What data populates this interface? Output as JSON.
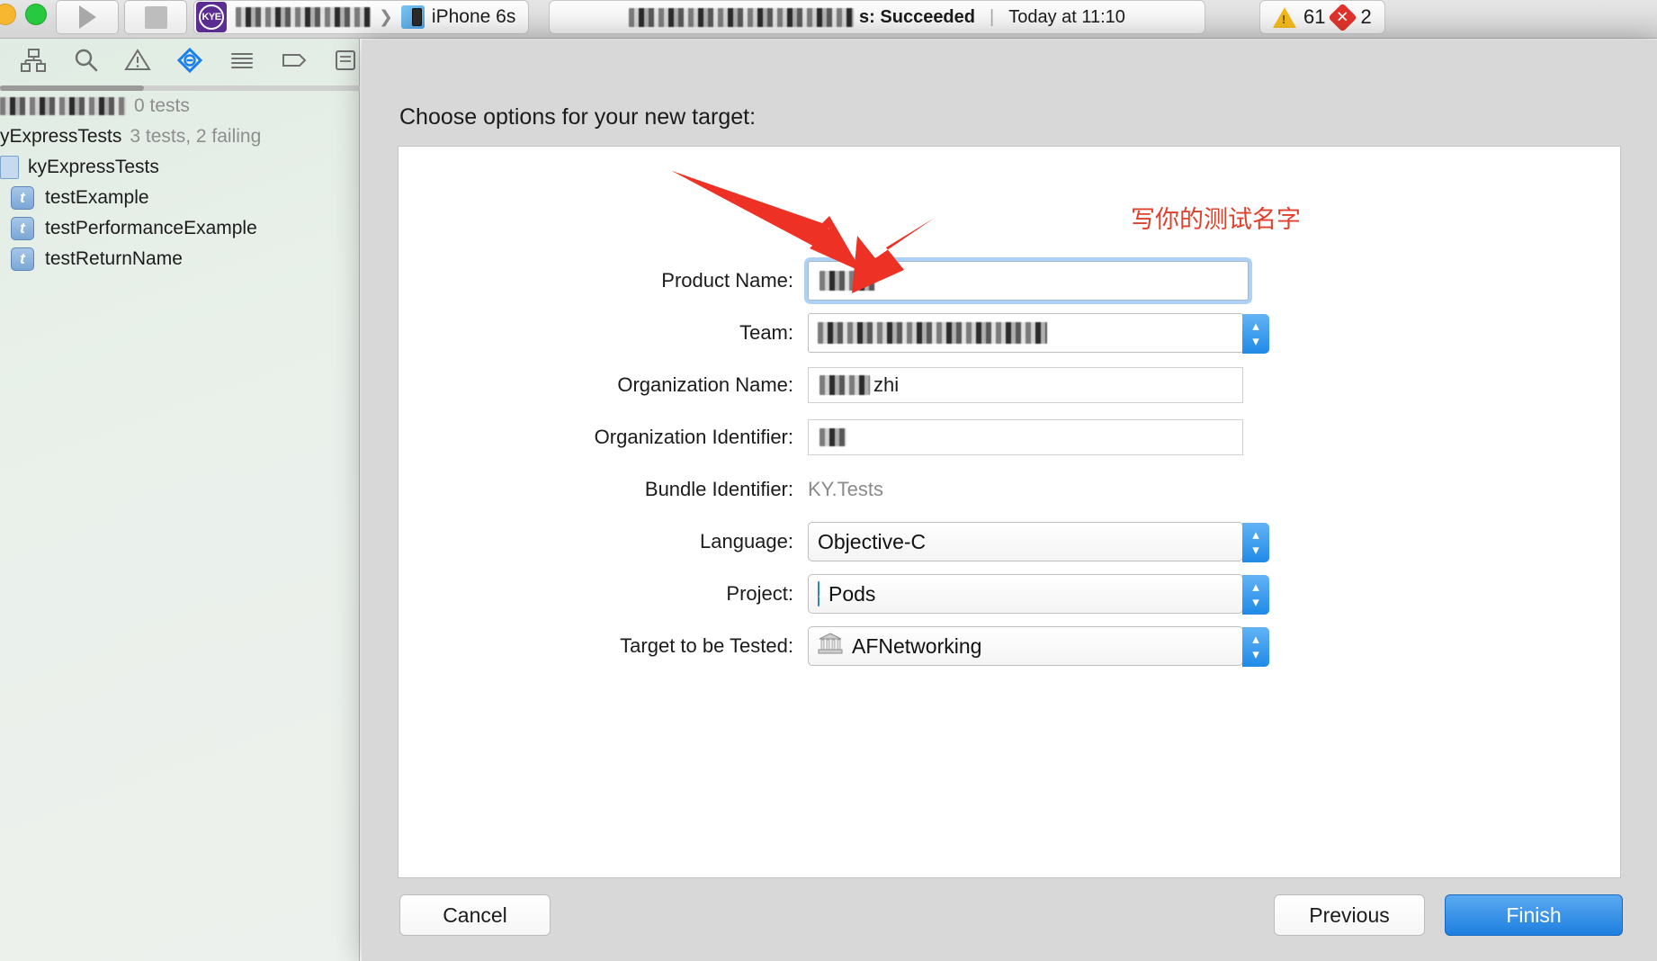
{
  "window": {
    "toolbar": {
      "run_label": "Run",
      "stop_label": "Stop",
      "scheme_badge": "KYE",
      "scheme_name_redacted": "",
      "device_name": "iPhone 6s",
      "device_icon": "iphone-icon",
      "status_redacted": "",
      "status_text": "s: Succeeded",
      "status_divider": "|",
      "status_time": "Today at 11:10",
      "warning_count": "61",
      "error_count": "2",
      "warning_icon": "warning-triangle-icon",
      "error_icon": "error-diamond-icon"
    }
  },
  "navigator": {
    "icons": [
      {
        "name": "project-navigator-icon",
        "label": "Project"
      },
      {
        "name": "search-navigator-icon",
        "label": "Search"
      },
      {
        "name": "issue-navigator-icon",
        "label": "Issues"
      },
      {
        "name": "test-navigator-icon",
        "label": "Tests"
      },
      {
        "name": "debug-navigator-icon",
        "label": "Debug"
      },
      {
        "name": "breakpoint-navigator-icon",
        "label": "Breakpoints"
      },
      {
        "name": "report-navigator-icon",
        "label": "Reports"
      }
    ],
    "rows": [
      {
        "name": "nav-row-project-redacted",
        "label": "",
        "count": "0 tests",
        "indent": 0,
        "icon": "none",
        "redacted": true
      },
      {
        "name": "nav-row-kyexpresstests-group",
        "label": "yExpressTests",
        "count": "3 tests, 2 failing",
        "indent": 0,
        "icon": "none",
        "redacted": false
      },
      {
        "name": "nav-row-kyexpresstests-class",
        "label": "kyExpressTests",
        "count": "",
        "indent": 1,
        "icon": "file",
        "redacted": false
      },
      {
        "name": "nav-row-testexample",
        "label": "testExample",
        "count": "",
        "indent": 2,
        "icon": "test",
        "redacted": false
      },
      {
        "name": "nav-row-testperformanceexample",
        "label": "testPerformanceExample",
        "count": "",
        "indent": 2,
        "icon": "test",
        "redacted": false
      },
      {
        "name": "nav-row-testreturnname",
        "label": "testReturnName",
        "count": "",
        "indent": 2,
        "icon": "test",
        "redacted": false
      }
    ]
  },
  "sheet": {
    "title": "Choose options for your new target:",
    "fields": [
      {
        "name": "product-name",
        "label": "Product Name:",
        "value": "",
        "redacted": true,
        "control": "textfield-focused",
        "stepper": false
      },
      {
        "name": "team",
        "label": "Team:",
        "value": "",
        "redacted": true,
        "control": "popup",
        "stepper": true
      },
      {
        "name": "organization-name",
        "label": "Organization Name:",
        "value": "zhi",
        "redacted": true,
        "control": "textfield",
        "stepper": false
      },
      {
        "name": "organization-identifier",
        "label": "Organization Identifier:",
        "value": "",
        "redacted": true,
        "control": "textfield",
        "stepper": false
      },
      {
        "name": "bundle-identifier",
        "label": "Bundle Identifier:",
        "value": "KY.Tests",
        "redacted": false,
        "control": "static",
        "stepper": false
      },
      {
        "name": "language",
        "label": "Language:",
        "value": "Objective-C",
        "redacted": false,
        "control": "popup",
        "stepper": true
      },
      {
        "name": "project",
        "label": "Project:",
        "value": "Pods",
        "redacted": false,
        "control": "popup",
        "icon": "xcode-project-icon",
        "stepper": true
      },
      {
        "name": "target-to-be-tested",
        "label": "Target to be Tested:",
        "value": "AFNetworking",
        "redacted": false,
        "control": "popup",
        "icon": "framework-icon",
        "stepper": true
      }
    ],
    "annotation": {
      "text": "写你的测试名字",
      "color": "#e0402c"
    },
    "buttons": {
      "cancel": "Cancel",
      "previous": "Previous",
      "finish": "Finish"
    }
  },
  "colors": {
    "accent_blue": "#1e7fe0",
    "annotation_red": "#e0402c",
    "warning_yellow": "#f2b91c",
    "error_red": "#e0322c",
    "navigator_bg": "#e9f0ea"
  }
}
